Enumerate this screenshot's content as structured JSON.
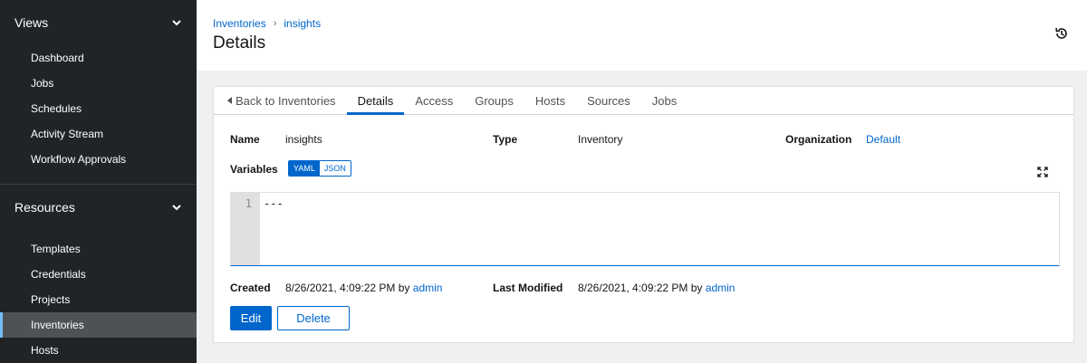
{
  "sidebar": {
    "groups": [
      {
        "label": "Views",
        "items": [
          {
            "label": "Dashboard"
          },
          {
            "label": "Jobs"
          },
          {
            "label": "Schedules"
          },
          {
            "label": "Activity Stream"
          },
          {
            "label": "Workflow Approvals"
          }
        ]
      },
      {
        "label": "Resources",
        "items": [
          {
            "label": "Templates"
          },
          {
            "label": "Credentials"
          },
          {
            "label": "Projects"
          },
          {
            "label": "Inventories",
            "active": true
          },
          {
            "label": "Hosts"
          }
        ]
      }
    ],
    "active_item": "Inventories",
    "colors": {
      "background": "#212427",
      "active_bg": "#4f5255",
      "active_indicator": "#73bcf7"
    }
  },
  "header": {
    "breadcrumb": [
      "Inventories",
      "insights"
    ],
    "title": "Details",
    "history_icon": "history-icon"
  },
  "tabs": [
    {
      "label": "Back to Inventories",
      "icon": "caret-left-icon"
    },
    {
      "label": "Details",
      "active": true
    },
    {
      "label": "Access"
    },
    {
      "label": "Groups"
    },
    {
      "label": "Hosts"
    },
    {
      "label": "Sources"
    },
    {
      "label": "Jobs"
    }
  ],
  "details": {
    "name_label": "Name",
    "name_value": "insights",
    "type_label": "Type",
    "type_value": "Inventory",
    "organization_label": "Organization",
    "organization_value": "Default",
    "variables_label": "Variables",
    "format_toggle": {
      "options": [
        "YAML",
        "JSON"
      ],
      "selected": "YAML"
    },
    "editor": {
      "line_numbers": [
        "1"
      ],
      "content": "---"
    },
    "created_label": "Created",
    "created_value": "8/26/2021, 4:09:22 PM by",
    "created_by": "admin",
    "modified_label": "Last Modified",
    "modified_value": "8/26/2021, 4:09:22 PM by",
    "modified_by": "admin"
  },
  "actions": {
    "edit_label": "Edit",
    "delete_label": "Delete"
  },
  "colors": {
    "accent": "#0066cc",
    "page_bg": "#f0f0f0"
  }
}
